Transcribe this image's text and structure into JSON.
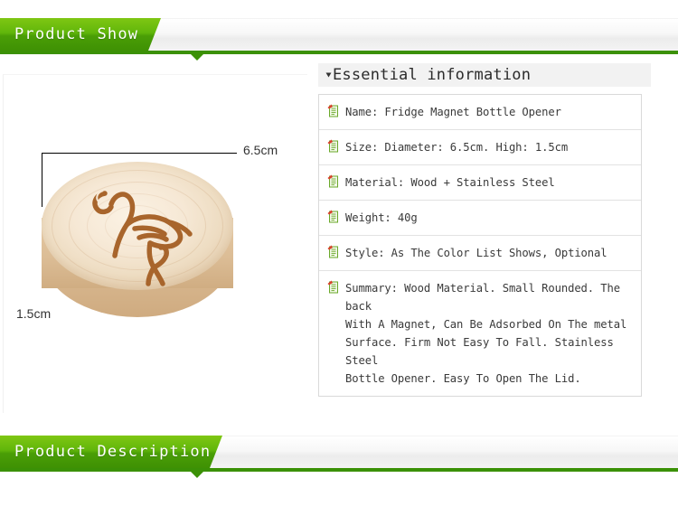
{
  "banners": {
    "top": {
      "title": "Product Show",
      "accent": "#3b9106",
      "tab_gradient_top": "#7fc713",
      "tab_gradient_bottom": "#3f9104"
    },
    "bottom": {
      "title": "Product Description",
      "accent": "#3b9106"
    }
  },
  "product_image": {
    "alt": "wooden-round-fridge-magnet-bottle-opener-with-flamingo-engraving",
    "dimension_width_label": "6.5cm",
    "dimension_height_label": "1.5cm",
    "wood_light": "#fbf2e4",
    "wood_mid": "#e6d0b2",
    "wood_side": "#d0ad82",
    "engraving_color": "#a8652c"
  },
  "info_panel": {
    "header_title": "Essential information",
    "caret_icon": "caret-down-icon",
    "row_icon": "note-document-icon",
    "rows": [
      {
        "icon": "note-document-icon",
        "text": "Name: Fridge Magnet Bottle Opener"
      },
      {
        "icon": "note-document-icon",
        "text": "Size: Diameter: 6.5cm. High: 1.5cm"
      },
      {
        "icon": "note-document-icon",
        "text": "Material: Wood + Stainless Steel"
      },
      {
        "icon": "note-document-icon",
        "text": "Weight: 40g"
      },
      {
        "icon": "note-document-icon",
        "text": "Style: As The Color List Shows, Optional"
      },
      {
        "icon": "note-document-icon",
        "text": "Summary: Wood Material. Small Rounded. The back\nWith A Magnet, Can Be Adsorbed On The metal\nSurface. Firm Not Easy To Fall. Stainless Steel\nBottle Opener. Easy To Open The Lid."
      }
    ]
  }
}
